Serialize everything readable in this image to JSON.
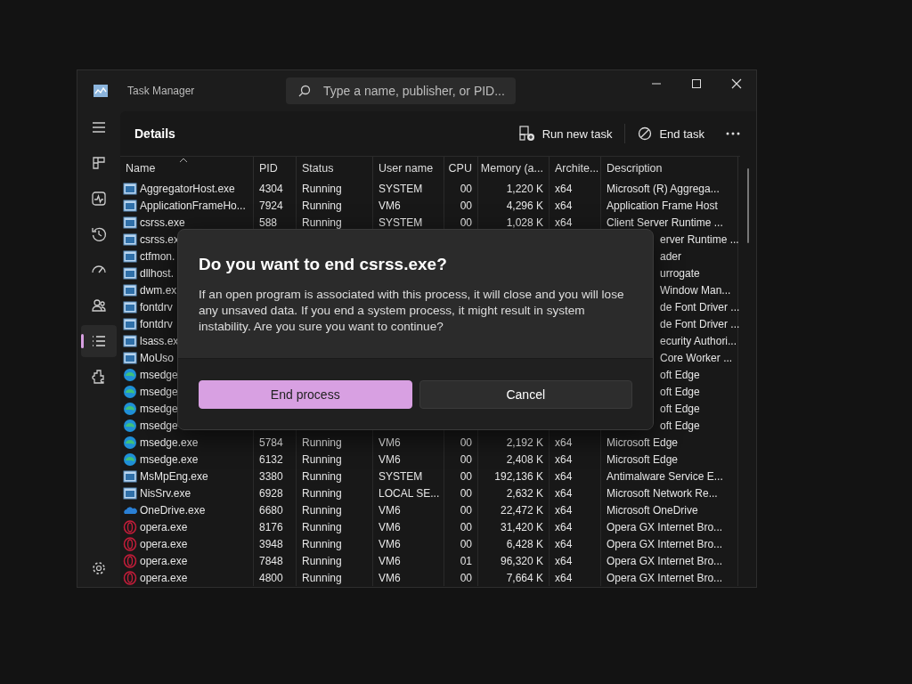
{
  "window": {
    "title": "Task Manager",
    "search": {
      "placeholder": "Type a name, publisher, or PID..."
    }
  },
  "nav": [
    {
      "kind": "menu",
      "selected": false
    },
    {
      "kind": "processes",
      "selected": false
    },
    {
      "kind": "performance",
      "selected": false
    },
    {
      "kind": "history",
      "selected": false
    },
    {
      "kind": "startup",
      "selected": false
    },
    {
      "kind": "users",
      "selected": false
    },
    {
      "kind": "details",
      "selected": true
    },
    {
      "kind": "services",
      "selected": false
    }
  ],
  "page": {
    "title": "Details",
    "actions": [
      {
        "kind": "run",
        "label": "Run new task"
      },
      {
        "kind": "end",
        "label": "End task"
      }
    ]
  },
  "table": {
    "columns": [
      "Name",
      "PID",
      "Status",
      "User name",
      "CPU",
      "Memory (a...",
      "Archite...",
      "Description"
    ],
    "rows": [
      {
        "kind": "app",
        "name": "AggregatorHost.exe",
        "pid": "4304",
        "status": "Running",
        "user": "SYSTEM",
        "cpu": "00",
        "memory": "1,220 K",
        "arch": "x64",
        "description": "Microsoft (R) Aggrega..."
      },
      {
        "kind": "app",
        "name": "ApplicationFrameHo...",
        "pid": "7924",
        "status": "Running",
        "user": "VM6",
        "cpu": "00",
        "memory": "4,296 K",
        "arch": "x64",
        "description": "Application Frame Host"
      },
      {
        "kind": "app",
        "name": "csrss.exe",
        "pid": "588",
        "status": "Running",
        "user": "SYSTEM",
        "cpu": "00",
        "memory": "1,028 K",
        "arch": "x64",
        "description": "Client Server Runtime ..."
      },
      {
        "kind": "app",
        "name": "csrss.ex",
        "description": "erver Runtime ..."
      },
      {
        "kind": "app",
        "name": "ctfmon.",
        "description": "ader"
      },
      {
        "kind": "app",
        "name": "dllhost.",
        "description": "urrogate"
      },
      {
        "kind": "app",
        "name": "dwm.ex",
        "description": "Window Man..."
      },
      {
        "kind": "app",
        "name": "fontdrv",
        "description": "de Font Driver ..."
      },
      {
        "kind": "app",
        "name": "fontdrv",
        "description": "de Font Driver ..."
      },
      {
        "kind": "app",
        "name": "lsass.ex",
        "description": "ecurity Authori..."
      },
      {
        "kind": "app",
        "name": "MoUso",
        "description": "Core Worker ..."
      },
      {
        "kind": "edge",
        "name": "msedge",
        "description": "oft Edge"
      },
      {
        "kind": "edge",
        "name": "msedge",
        "description": "oft Edge"
      },
      {
        "kind": "edge",
        "name": "msedge",
        "description": "oft Edge"
      },
      {
        "kind": "edge",
        "name": "msedge",
        "description": "oft Edge"
      },
      {
        "kind": "edge",
        "name": "msedge.exe",
        "pid": "5784",
        "status": "Running",
        "user": "VM6",
        "cpu": "00",
        "memory": "2,192 K",
        "arch": "x64",
        "description": "Microsoft Edge"
      },
      {
        "kind": "edge",
        "name": "msedge.exe",
        "pid": "6132",
        "status": "Running",
        "user": "VM6",
        "cpu": "00",
        "memory": "2,408 K",
        "arch": "x64",
        "description": "Microsoft Edge"
      },
      {
        "kind": "app",
        "name": "MsMpEng.exe",
        "pid": "3380",
        "status": "Running",
        "user": "SYSTEM",
        "cpu": "00",
        "memory": "192,136 K",
        "arch": "x64",
        "description": "Antimalware Service E..."
      },
      {
        "kind": "app",
        "name": "NisSrv.exe",
        "pid": "6928",
        "status": "Running",
        "user": "LOCAL SE...",
        "cpu": "00",
        "memory": "2,632 K",
        "arch": "x64",
        "description": "Microsoft Network Re..."
      },
      {
        "kind": "cloud",
        "name": "OneDrive.exe",
        "pid": "6680",
        "status": "Running",
        "user": "VM6",
        "cpu": "00",
        "memory": "22,472 K",
        "arch": "x64",
        "description": "Microsoft OneDrive"
      },
      {
        "kind": "opera",
        "name": "opera.exe",
        "pid": "8176",
        "status": "Running",
        "user": "VM6",
        "cpu": "00",
        "memory": "31,420 K",
        "arch": "x64",
        "description": "Opera GX Internet Bro..."
      },
      {
        "kind": "opera",
        "name": "opera.exe",
        "pid": "3948",
        "status": "Running",
        "user": "VM6",
        "cpu": "00",
        "memory": "6,428 K",
        "arch": "x64",
        "description": "Opera GX Internet Bro..."
      },
      {
        "kind": "opera",
        "name": "opera.exe",
        "pid": "7848",
        "status": "Running",
        "user": "VM6",
        "cpu": "01",
        "memory": "96,320 K",
        "arch": "x64",
        "description": "Opera GX Internet Bro..."
      },
      {
        "kind": "opera",
        "name": "opera.exe",
        "pid": "4800",
        "status": "Running",
        "user": "VM6",
        "cpu": "00",
        "memory": "7,664 K",
        "arch": "x64",
        "description": "Opera GX Internet Bro..."
      }
    ]
  },
  "dialog": {
    "title": "Do you want to end csrss.exe?",
    "message": "If an open program is associated with this process, it will close and you will lose any unsaved data. If you end a system process, it might result in system instability. Are you sure you want to continue?",
    "buttons": [
      {
        "label": "End process",
        "primary": true
      },
      {
        "label": "Cancel",
        "primary": false
      }
    ]
  }
}
